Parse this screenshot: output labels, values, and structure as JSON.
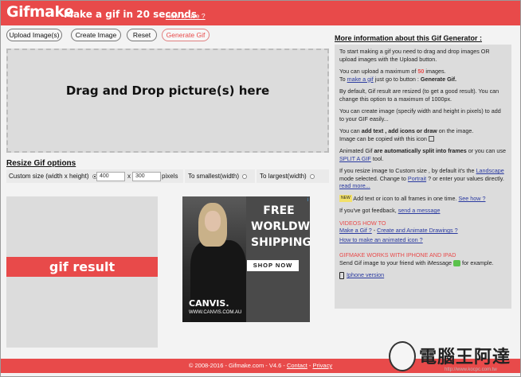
{
  "header": {
    "logo": "Gifmake",
    "tagline": "Make a gif in 20 seconds",
    "how_to": "How to use ?"
  },
  "toolbar": {
    "upload": "Upload Image(s)",
    "create": "Create Image",
    "reset": "Reset",
    "generate": "Generate Gif"
  },
  "dropzone": {
    "text": "Drag and Drop picture(s) here"
  },
  "resize": {
    "title": "Resize Gif options",
    "custom_label": "Custom size (width x height)",
    "width": "400",
    "x": "x",
    "height": "300",
    "pixels": "pixels",
    "smallest": "To smallest(width)",
    "largest": "To largest(width)"
  },
  "result": {
    "label": "gif result"
  },
  "ad": {
    "free": "FREE",
    "worldwide": "WORLDWIDE",
    "shipping": "SHIPPING",
    "shop": "SHOP NOW",
    "brand": "CANVIS.",
    "url": "WWW.CANVIS.COM.AU",
    "info": "i"
  },
  "sidebar": {
    "title": "More information about this Gif Generator :",
    "p1": "To start making a gif you need to drag and drop images OR upload images with the Upload button.",
    "p2a": "You can upload a maximum of ",
    "p2n": "50",
    "p2b": " images.",
    "p2c": "To ",
    "p2link": "make a gif",
    "p2d": " just go to button : ",
    "p2e": "Generate Gif.",
    "p3": "By default, Gif result are resized (to get a good result). You can change this option to a maximum of 1000px.",
    "p4": "You can create image (specify width and height in pixels) to add to your GIF easily...",
    "p5a": "You can ",
    "p5b": "add text , add icons or draw",
    "p5c": " on the image.",
    "p5d": "Image can be copied with this icon",
    "p6a": "Animated Gif ",
    "p6b": "are automatically split into frames",
    "p6c": " or you can use ",
    "p6link": "SPLIT A GIF",
    "p6d": " tool.",
    "p7a": "If you resize image to Custom size , by default it's the ",
    "p7l1": "Landscape",
    "p7b": " mode selected. Change to ",
    "p7l2": "Portrait",
    "p7c": " ? or enter your values directly. ",
    "p7l3": "read more...",
    "p8new": "NEW",
    "p8a": " Add text or icon to all frames in one time. ",
    "p8l": "See how ?",
    "p9a": "If you've got feedback, ",
    "p9l": "send a message",
    "videos_title": "VIDEOS HOW TO",
    "v1": "Make a Gif ?",
    "v_sep": " - ",
    "v2": "Create and Animate Drawings ?",
    "v3": "How to make an animated icon ?",
    "iphone_title": "GIFMAKE WORKS WITH IPHONE AND IPAD",
    "iphone_a": "Send Gif image to your friend with iMessage ",
    "iphone_b": " for example.",
    "iphone_link": "Iphone version"
  },
  "footer": {
    "copy": "© 2008-2016 - Gifmake.com - V4.6 - ",
    "contact": "Contact",
    "sep": " - ",
    "privacy": "Privacy"
  },
  "watermark": {
    "text": "電腦王阿達",
    "url": "http://www.kocpc.com.tw"
  },
  "colors": {
    "brand_red": "#e84a4a",
    "panel_gray": "#dcdcdc",
    "link_blue": "#2a3aa0"
  }
}
